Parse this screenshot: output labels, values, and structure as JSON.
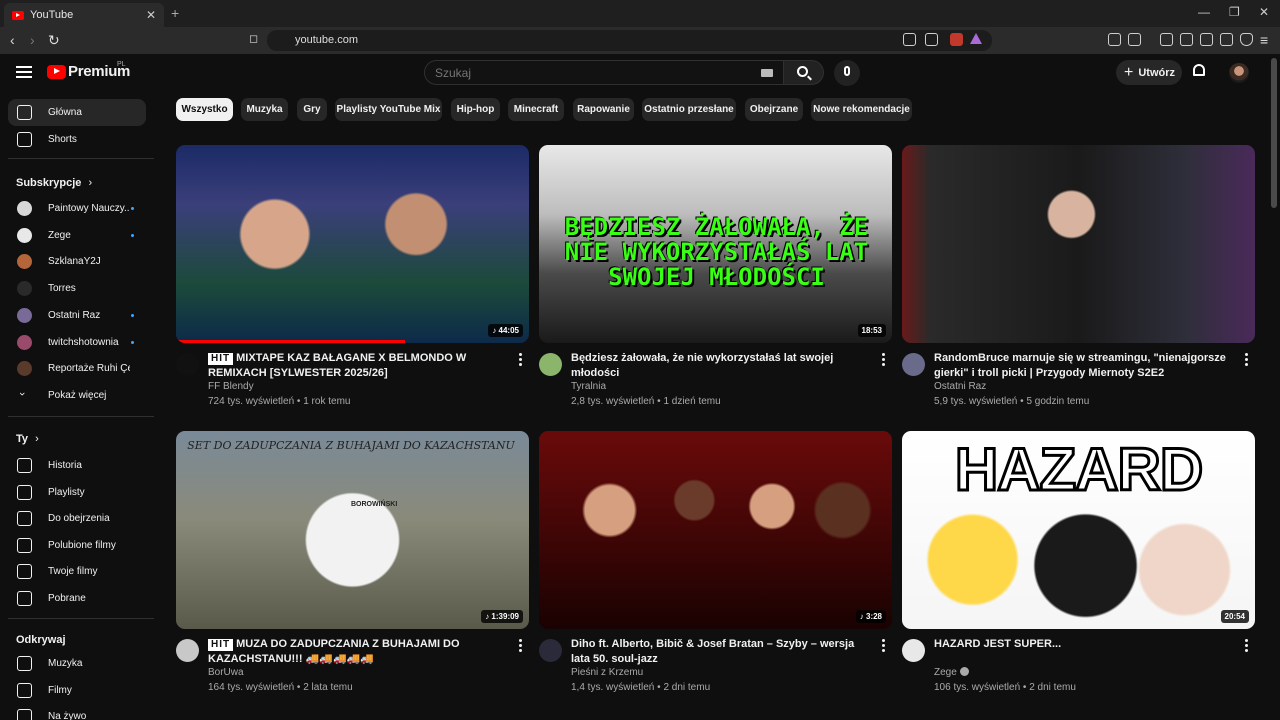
{
  "browser": {
    "tab_title": "YouTube",
    "tab_close": "✕",
    "new_tab": "+",
    "url": "youtube.com",
    "win_min": "—",
    "win_restore": "❐",
    "win_close": "✕"
  },
  "masthead": {
    "logo_text": "Premium",
    "logo_region": "PL",
    "search_placeholder": "Szukaj",
    "create_label": "Utwórz"
  },
  "chips": [
    {
      "label": "Wszystko",
      "selected": true
    },
    {
      "label": "Muzyka"
    },
    {
      "label": "Gry"
    },
    {
      "label": "Playlisty YouTube Mix"
    },
    {
      "label": "Hip-hop"
    },
    {
      "label": "Minecraft"
    },
    {
      "label": "Rapowanie"
    },
    {
      "label": "Ostatnio przesłane"
    },
    {
      "label": "Obejrzane"
    },
    {
      "label": "Nowe rekomendacje"
    }
  ],
  "sidebar": {
    "main": [
      {
        "label": "Główna",
        "icon": "home-icon"
      },
      {
        "label": "Shorts",
        "icon": "shorts-icon"
      }
    ],
    "subs_heading": "Subskrypcje",
    "subs": [
      {
        "label": "Paintowy Nauczy...",
        "color": "#d8d8d8",
        "new": true
      },
      {
        "label": "Zege",
        "color": "#e8e8e8",
        "new": true
      },
      {
        "label": "SzklanaY2J",
        "color": "#b5653a",
        "new": false
      },
      {
        "label": "Torres",
        "color": "#2a2a2a",
        "new": false
      },
      {
        "label": "Ostatni Raz",
        "color": "#7a6a9a",
        "new": true
      },
      {
        "label": "twitchshotownia",
        "color": "#9a4a6a",
        "new": true
      },
      {
        "label": "Reportaże Ruhi Çen...",
        "color": "#5a3a2a",
        "new": false
      },
      {
        "label": "Pokaż więcej",
        "color": "",
        "new": false
      }
    ],
    "you_heading": "Ty",
    "you": [
      {
        "label": "Historia",
        "icon": "history-icon"
      },
      {
        "label": "Playlisty",
        "icon": "playlists-icon"
      },
      {
        "label": "Do obejrzenia",
        "icon": "watch-later-icon"
      },
      {
        "label": "Polubione filmy",
        "icon": "liked-icon"
      },
      {
        "label": "Twoje filmy",
        "icon": "your-videos-icon"
      },
      {
        "label": "Pobrane",
        "icon": "downloads-icon"
      }
    ],
    "explore_heading": "Odkrywaj",
    "explore": [
      {
        "label": "Muzyka",
        "icon": "music-icon"
      },
      {
        "label": "Filmy",
        "icon": "movies-icon"
      },
      {
        "label": "Na żywo",
        "icon": "live-icon"
      }
    ]
  },
  "videos": [
    {
      "hit": "HIT",
      "title": "MIXTAPE KAZ BAŁAGANE X BELMONDO W REMIXACH [SYLWESTER 2025/26]",
      "channel": "FF Blendy",
      "views": "724 tys. wyświetleń",
      "age": "1 rok temu",
      "duration": "♪ 44:05",
      "progress": 0.65,
      "avatar_color": "#111"
    },
    {
      "title": "Będziesz żałowała, że nie wykorzystałaś lat swojej młodości",
      "channel": "Tyralnia",
      "views": "2,8 tys. wyświetleń",
      "age": "1 dzień temu",
      "duration": "18:53",
      "thumb_text": "BĘDZIESZ ŻAŁOWAŁA, ŻE NIE WYKORZYSTAŁAŚ LAT SWOJEJ MŁODOŚCI",
      "avatar_color": "#8ab56a"
    },
    {
      "title": "RandomBruce marnuje się w streamingu, \"nienajgorsze gierki\" i troll picki | Przygody Miernoty S2E2",
      "channel": "Ostatni Raz",
      "views": "5,9 tys. wyświetleń",
      "age": "5 godzin temu",
      "avatar_color": "#6a6a8a"
    },
    {
      "hit": "HIT",
      "title": "MUZA DO ZADUPCZANIA Z BUHAJAMI DO KAZACHSTANU!!! 🚚🚚🚚🚚🚚",
      "channel": "BorUwa",
      "views": "164 tys. wyświetleń",
      "age": "2 lata temu",
      "duration": "♪ 1:39:09",
      "thumb_caption": "SET DO ZADUPCZANIA Z BUHAJAMI DO KAZACHSTANU",
      "truck_label": "BOROWIŃSKI",
      "avatar_color": "#c8c8c8"
    },
    {
      "title": "Diho ft. Alberto, Bibič & Josef Bratan – Szyby – wersja lata 50. soul-jazz",
      "channel": "Pieśni z Krzemu",
      "views": "1,4 tys. wyświetleń",
      "age": "2 dni temu",
      "duration": "♪ 3:28",
      "avatar_color": "#2a2a3a"
    },
    {
      "title": "HAZARD JEST SUPER...",
      "channel": "Zege",
      "views": "106 tys. wyświetleń",
      "age": "2 dni temu",
      "duration": "20:54",
      "thumb_text": "HAZARD",
      "avatar_color": "#e8e8e8",
      "verified": true
    }
  ],
  "colors": {
    "background": "#0f0f0f",
    "accent": "#ff0000",
    "chip": "#272727",
    "text_secondary": "#aaaaaa"
  }
}
